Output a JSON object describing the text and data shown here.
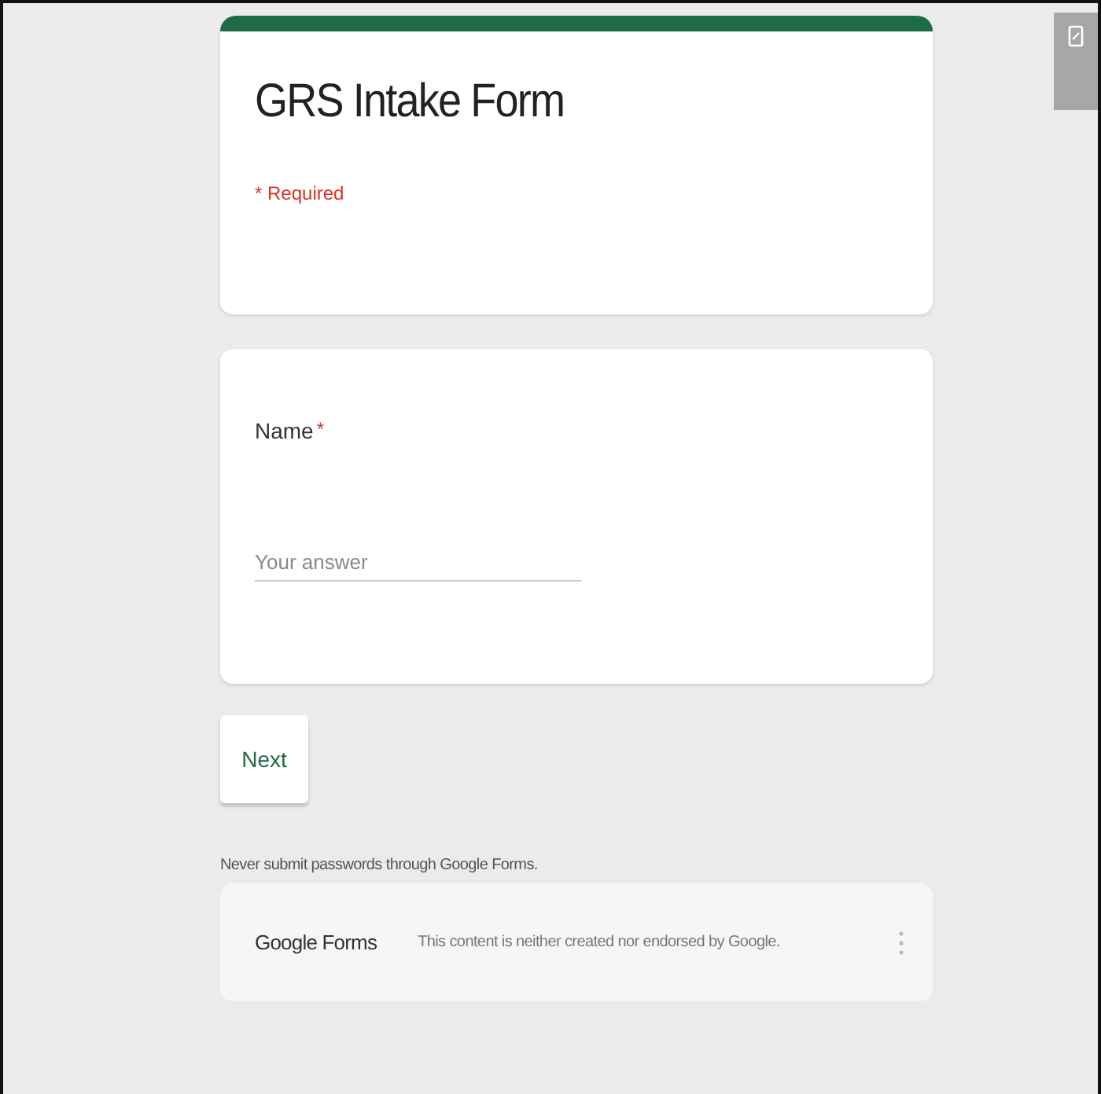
{
  "header": {
    "title": "GRS Intake Form",
    "required_note": "* Required"
  },
  "question": {
    "title": "Name",
    "required_mark": "*",
    "placeholder": "Your answer"
  },
  "next_button": "Next",
  "warning": "Never submit passwords through Google Forms.",
  "footer": {
    "brand": "Google Forms",
    "disclaimer": "This content is neither created nor endorsed by Google."
  }
}
